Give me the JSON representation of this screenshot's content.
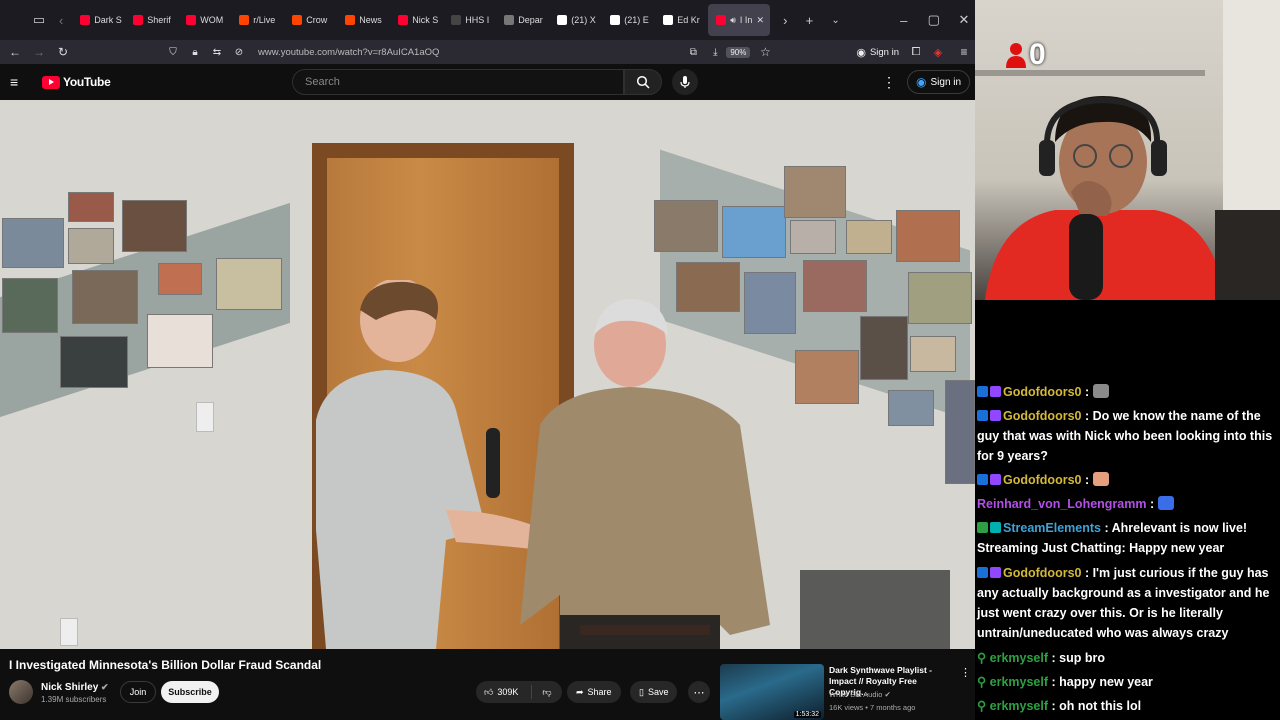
{
  "browser": {
    "tabs": [
      {
        "label": "Dark S",
        "color": "#ff0033"
      },
      {
        "label": "Sherif",
        "color": "#ff0033"
      },
      {
        "label": "WOM",
        "color": "#ff0033"
      },
      {
        "label": "r/Live",
        "color": "#ff4500"
      },
      {
        "label": "Crow",
        "color": "#ff4500"
      },
      {
        "label": "News",
        "color": "#ff4500"
      },
      {
        "label": "Nick S",
        "color": "#ff0033"
      },
      {
        "label": "HHS I",
        "color": "#444444"
      },
      {
        "label": "Depar",
        "color": "#777777"
      },
      {
        "label": "(21) X",
        "color": "#ffffff"
      },
      {
        "label": "(21) E",
        "color": "#ffffff"
      },
      {
        "label": "Ed Kr",
        "color": "#ffffff"
      },
      {
        "label": "I In",
        "color": "#ff0033"
      }
    ],
    "url": "www.youtube.com/watch?v=r8AuICA1aOQ",
    "zoom": "90%",
    "signin": "Sign in"
  },
  "youtube": {
    "logo": "YouTube",
    "search_placeholder": "Search",
    "signin": "Sign in"
  },
  "video": {
    "title": "I Investigated Minnesota's Billion Dollar Fraud Scandal",
    "channel": "Nick Shirley",
    "subscribers": "1.39M subscribers",
    "join": "Join",
    "subscribe": "Subscribe",
    "likes": "309K",
    "share": "Share",
    "save": "Save"
  },
  "recommended": {
    "title": "Dark Synthwave Playlist - Impact // Royalty Free Copyrig...",
    "channel": "White Bat Audio",
    "meta": "16K views • 7 months ago",
    "duration": "1:53:32"
  },
  "webcam": {
    "counter": "0"
  },
  "chat": [
    {
      "user": "Godofdoors0",
      "color": "#d4b83a",
      "badges": [
        "#1a6fd8",
        "#9146ff"
      ],
      "text": "",
      "emote": "#8a8a8a"
    },
    {
      "user": "Godofdoors0",
      "color": "#d4b83a",
      "badges": [
        "#1a6fd8",
        "#9146ff"
      ],
      "text": "Do we know the name of the guy that was with Nick who been looking into this for 9 years?"
    },
    {
      "user": "Godofdoors0",
      "color": "#d4b83a",
      "badges": [
        "#1a6fd8",
        "#9146ff"
      ],
      "text": "",
      "emote": "#e6a080"
    },
    {
      "user": "Reinhard_von_Lohengramm",
      "color": "#b34fe8",
      "badges": [],
      "text": "",
      "emote": "#3a6ee8"
    },
    {
      "user": "StreamElements",
      "color": "#3fa3d6",
      "badges": [
        "#2ea043",
        "#00b0b0"
      ],
      "text": "Ahrelevant is now live! Streaming Just Chatting: Happy new year"
    },
    {
      "user": "Godofdoors0",
      "color": "#d4b83a",
      "badges": [
        "#1a6fd8",
        "#9146ff"
      ],
      "text": "I'm just curious if the guy has any actually background as a investigator and he just went crazy over this. Or is he literally untrain/uneducated who was always crazy"
    },
    {
      "user": "erkmyself",
      "color": "#2ea043",
      "badges": [],
      "text": "sup bro",
      "person": true
    },
    {
      "user": "erkmyself",
      "color": "#2ea043",
      "badges": [],
      "text": "happy new year",
      "person": true
    },
    {
      "user": "erkmyself",
      "color": "#2ea043",
      "badges": [],
      "text": "oh not this lol",
      "person": true
    }
  ]
}
